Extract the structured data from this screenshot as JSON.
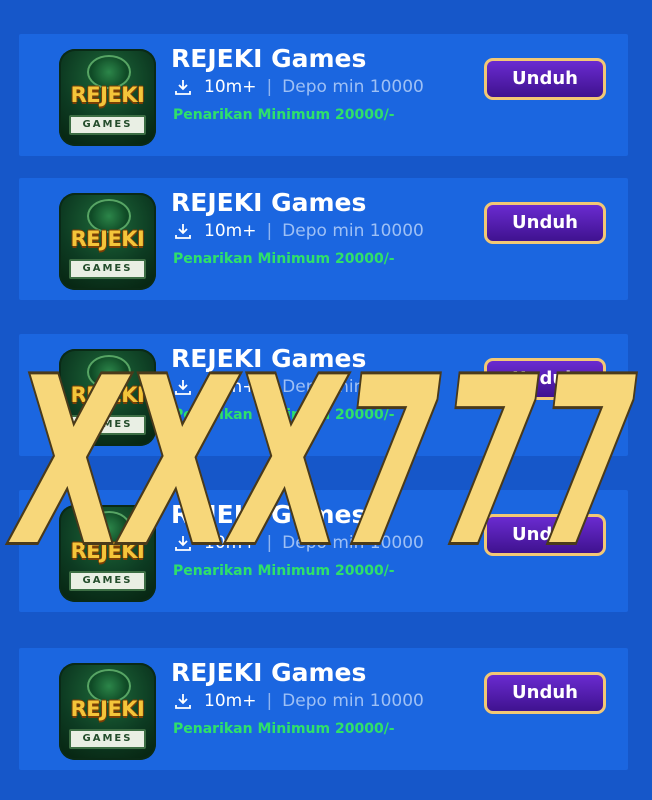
{
  "apps": [
    {
      "name": "REJEKI Games",
      "downloads": "10m+",
      "divider": "|",
      "deposit": "Depo min 10000",
      "withdraw": "Penarikan Minimum 20000/-",
      "button": "Unduh",
      "icon_logo": "REJEKI",
      "icon_sublogo": "GAMES"
    },
    {
      "name": "REJEKI Games",
      "downloads": "10m+",
      "divider": "|",
      "deposit": "Depo min 10000",
      "withdraw": "Penarikan Minimum 20000/-",
      "button": "Unduh",
      "icon_logo": "REJEKI",
      "icon_sublogo": "GAMES"
    },
    {
      "name": "REJEKI Games",
      "downloads": "10m+",
      "divider": "|",
      "deposit": "Depo min 10000",
      "withdraw": "Penarikan Minimum 20000/-",
      "button": "Unduh",
      "icon_logo": "REJEKI",
      "icon_sublogo": "GAMES"
    },
    {
      "name": "REJEKI Games",
      "downloads": "10m+",
      "divider": "|",
      "deposit": "Depo min 10000",
      "withdraw": "Penarikan Minimum 20000/-",
      "button": "Unduh",
      "icon_logo": "REJEKI",
      "icon_sublogo": "GAMES"
    },
    {
      "name": "REJEKI Games",
      "downloads": "10m+",
      "divider": "|",
      "deposit": "Depo min 10000",
      "withdraw": "Penarikan Minimum 20000/-",
      "button": "Unduh",
      "icon_logo": "REJEKI",
      "icon_sublogo": "GAMES"
    }
  ],
  "watermark": {
    "text": "XXX777"
  },
  "colors": {
    "background": "#1657c9",
    "card": "#1b66e0",
    "button": "#4a1aa8",
    "button_border": "#f2c875",
    "withdraw_text": "#2fe06a",
    "watermark_fill": "#f7d77a",
    "watermark_outline": "#4a3a1a"
  },
  "icons": {
    "download": "download-icon"
  }
}
